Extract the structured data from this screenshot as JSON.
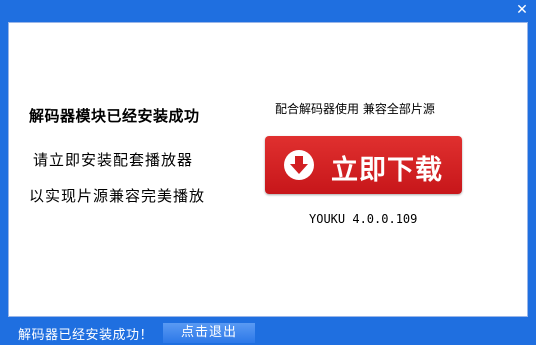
{
  "titlebar": {
    "close_glyph": "✕"
  },
  "left": {
    "headline": "解码器模块已经安装成功",
    "line2": "请立即安装配套播放器",
    "line3": "以实现片源兼容完美播放"
  },
  "right": {
    "caption": "配合解码器使用  兼容全部片源",
    "install_button": "立即下载",
    "version": "YOUKU 4.0.0.109"
  },
  "status": {
    "message": "解码器已经安装成功！",
    "exit_button": "点击退出"
  },
  "colors": {
    "frame_blue": "#1f6fe0",
    "button_red": "#d21f22"
  },
  "icons": {
    "download": "download-arrow-icon",
    "close": "close-icon"
  }
}
